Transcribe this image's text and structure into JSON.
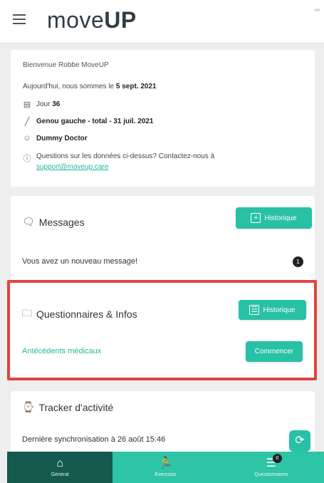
{
  "header": {
    "logo_light": "move",
    "logo_bold": "UP",
    "corner_text": "MB"
  },
  "info": {
    "welcome": "Bienvenue Robbe MoveUP",
    "date_prefix": "Aujourd'hui, nous sommes le",
    "date_value": "5 sept. 2021",
    "day_label": "Jour",
    "day_value": "36",
    "surgery": "Genou gauche - total - 31 juil. 2021",
    "doctor": "Dummy Doctor",
    "question": "Questions sur les données ci-dessus? Contactez-nous à",
    "email": "support@moveup.care"
  },
  "messages": {
    "title": "Messages",
    "button": "Historique",
    "text": "Vous avez un nouveau message!",
    "badge": "1"
  },
  "questionnaires": {
    "title": "Questionnaires & Infos",
    "button": "Historique",
    "item": "Antécédents médicaux",
    "start_button": "Commencer"
  },
  "tracker": {
    "title": "Tracker d'activité",
    "sync_text": "Dernière synchronisation à 26 août 15:46"
  },
  "nav": {
    "items": [
      {
        "label": "Général",
        "icon": "home-icon"
      },
      {
        "label": "Exercices",
        "icon": "exercise-icon"
      },
      {
        "label": "Questionnaires",
        "icon": "list-icon",
        "badge": "0"
      }
    ]
  },
  "colors": {
    "accent": "#28c1a5",
    "nav_active": "#145a4f",
    "highlight": "#e1453f"
  }
}
